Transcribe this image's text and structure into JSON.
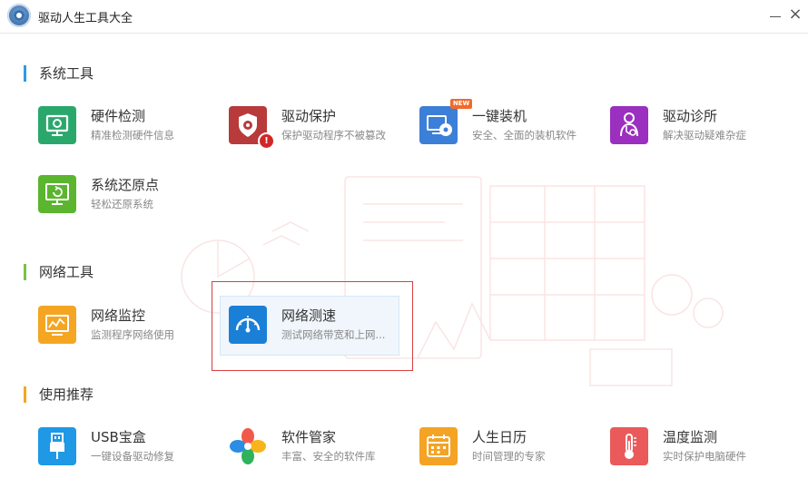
{
  "window": {
    "title": "驱动人生工具大全",
    "minimize_label": "—",
    "close_label": "×"
  },
  "sections": [
    {
      "label": "系统工具",
      "color": "#2b9be8"
    },
    {
      "label": "网络工具",
      "color": "#7cc243"
    },
    {
      "label": "使用推荐",
      "color": "#f5a623"
    }
  ],
  "tools": {
    "hardware_check": {
      "name": "硬件检测",
      "desc": "精准检测硬件信息",
      "color": "#2aa86b"
    },
    "driver_protect": {
      "name": "驱动保护",
      "desc": "保护驱动程序不被篡改",
      "color": "#b83a3a"
    },
    "one_key_install": {
      "name": "一键装机",
      "desc": "安全、全面的装机软件",
      "color": "#3c7fd8",
      "badge": "NEW"
    },
    "driver_clinic": {
      "name": "驱动诊所",
      "desc": "解决驱动疑难杂症",
      "color": "#9b2fbf"
    },
    "restore_point": {
      "name": "系统还原点",
      "desc": "轻松还原系统",
      "color": "#5bb52f"
    },
    "net_monitor": {
      "name": "网络监控",
      "desc": "监测程序网络使用",
      "color": "#f4a622"
    },
    "net_speed": {
      "name": "网络测速",
      "desc": "测试网络带宽和上网...",
      "color": "#1a7fd6"
    },
    "usb_box": {
      "name": "USB宝盒",
      "desc": "一键设备驱动修复",
      "color": "#1f98e6"
    },
    "soft_manager": {
      "name": "软件管家",
      "desc": "丰富、安全的软件库",
      "colors": [
        "#f15a4a",
        "#f8b41c",
        "#2fb25a",
        "#2b8de3"
      ]
    },
    "life_calendar": {
      "name": "人生日历",
      "desc": "时间管理的专家",
      "color": "#f4a324"
    },
    "temp_monitor": {
      "name": "温度监测",
      "desc": "实时保护电脑硬件",
      "color": "#ea5a5a"
    }
  },
  "icons": {
    "hardware_check": "monitor-icon",
    "driver_protect": "shield-gear-icon",
    "one_key_install": "screen-disc-icon",
    "driver_clinic": "doctor-icon",
    "restore_point": "restore-icon",
    "net_monitor": "chart-monitor-icon",
    "net_speed": "speedometer-icon",
    "usb_box": "usb-icon",
    "soft_manager": "petals-icon",
    "life_calendar": "calendar-icon",
    "temp_monitor": "thermometer-icon"
  }
}
